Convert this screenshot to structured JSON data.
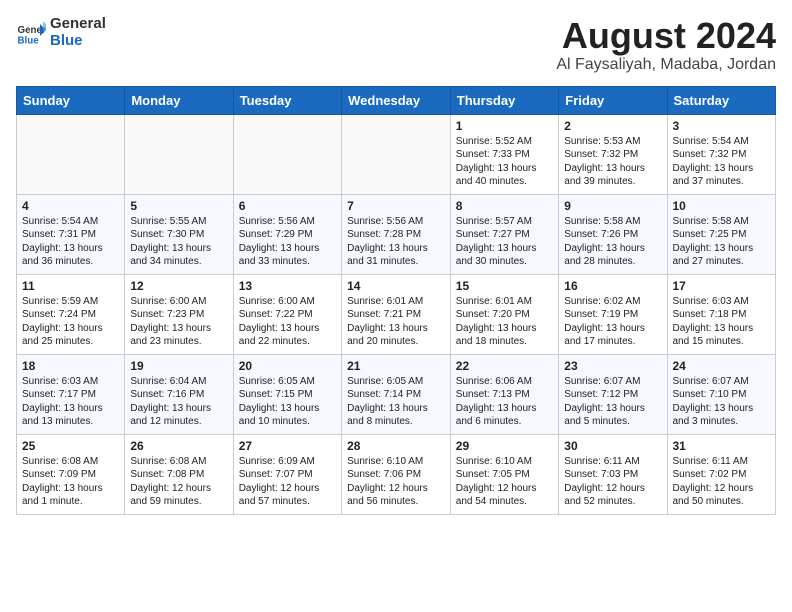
{
  "header": {
    "logo_line1": "General",
    "logo_line2": "Blue",
    "main_title": "August 2024",
    "subtitle": "Al Faysaliyah, Madaba, Jordan"
  },
  "weekdays": [
    "Sunday",
    "Monday",
    "Tuesday",
    "Wednesday",
    "Thursday",
    "Friday",
    "Saturday"
  ],
  "weeks": [
    [
      {
        "day": "",
        "info": ""
      },
      {
        "day": "",
        "info": ""
      },
      {
        "day": "",
        "info": ""
      },
      {
        "day": "",
        "info": ""
      },
      {
        "day": "1",
        "info": "Sunrise: 5:52 AM\nSunset: 7:33 PM\nDaylight: 13 hours\nand 40 minutes."
      },
      {
        "day": "2",
        "info": "Sunrise: 5:53 AM\nSunset: 7:32 PM\nDaylight: 13 hours\nand 39 minutes."
      },
      {
        "day": "3",
        "info": "Sunrise: 5:54 AM\nSunset: 7:32 PM\nDaylight: 13 hours\nand 37 minutes."
      }
    ],
    [
      {
        "day": "4",
        "info": "Sunrise: 5:54 AM\nSunset: 7:31 PM\nDaylight: 13 hours\nand 36 minutes."
      },
      {
        "day": "5",
        "info": "Sunrise: 5:55 AM\nSunset: 7:30 PM\nDaylight: 13 hours\nand 34 minutes."
      },
      {
        "day": "6",
        "info": "Sunrise: 5:56 AM\nSunset: 7:29 PM\nDaylight: 13 hours\nand 33 minutes."
      },
      {
        "day": "7",
        "info": "Sunrise: 5:56 AM\nSunset: 7:28 PM\nDaylight: 13 hours\nand 31 minutes."
      },
      {
        "day": "8",
        "info": "Sunrise: 5:57 AM\nSunset: 7:27 PM\nDaylight: 13 hours\nand 30 minutes."
      },
      {
        "day": "9",
        "info": "Sunrise: 5:58 AM\nSunset: 7:26 PM\nDaylight: 13 hours\nand 28 minutes."
      },
      {
        "day": "10",
        "info": "Sunrise: 5:58 AM\nSunset: 7:25 PM\nDaylight: 13 hours\nand 27 minutes."
      }
    ],
    [
      {
        "day": "11",
        "info": "Sunrise: 5:59 AM\nSunset: 7:24 PM\nDaylight: 13 hours\nand 25 minutes."
      },
      {
        "day": "12",
        "info": "Sunrise: 6:00 AM\nSunset: 7:23 PM\nDaylight: 13 hours\nand 23 minutes."
      },
      {
        "day": "13",
        "info": "Sunrise: 6:00 AM\nSunset: 7:22 PM\nDaylight: 13 hours\nand 22 minutes."
      },
      {
        "day": "14",
        "info": "Sunrise: 6:01 AM\nSunset: 7:21 PM\nDaylight: 13 hours\nand 20 minutes."
      },
      {
        "day": "15",
        "info": "Sunrise: 6:01 AM\nSunset: 7:20 PM\nDaylight: 13 hours\nand 18 minutes."
      },
      {
        "day": "16",
        "info": "Sunrise: 6:02 AM\nSunset: 7:19 PM\nDaylight: 13 hours\nand 17 minutes."
      },
      {
        "day": "17",
        "info": "Sunrise: 6:03 AM\nSunset: 7:18 PM\nDaylight: 13 hours\nand 15 minutes."
      }
    ],
    [
      {
        "day": "18",
        "info": "Sunrise: 6:03 AM\nSunset: 7:17 PM\nDaylight: 13 hours\nand 13 minutes."
      },
      {
        "day": "19",
        "info": "Sunrise: 6:04 AM\nSunset: 7:16 PM\nDaylight: 13 hours\nand 12 minutes."
      },
      {
        "day": "20",
        "info": "Sunrise: 6:05 AM\nSunset: 7:15 PM\nDaylight: 13 hours\nand 10 minutes."
      },
      {
        "day": "21",
        "info": "Sunrise: 6:05 AM\nSunset: 7:14 PM\nDaylight: 13 hours\nand 8 minutes."
      },
      {
        "day": "22",
        "info": "Sunrise: 6:06 AM\nSunset: 7:13 PM\nDaylight: 13 hours\nand 6 minutes."
      },
      {
        "day": "23",
        "info": "Sunrise: 6:07 AM\nSunset: 7:12 PM\nDaylight: 13 hours\nand 5 minutes."
      },
      {
        "day": "24",
        "info": "Sunrise: 6:07 AM\nSunset: 7:10 PM\nDaylight: 13 hours\nand 3 minutes."
      }
    ],
    [
      {
        "day": "25",
        "info": "Sunrise: 6:08 AM\nSunset: 7:09 PM\nDaylight: 13 hours\nand 1 minute."
      },
      {
        "day": "26",
        "info": "Sunrise: 6:08 AM\nSunset: 7:08 PM\nDaylight: 12 hours\nand 59 minutes."
      },
      {
        "day": "27",
        "info": "Sunrise: 6:09 AM\nSunset: 7:07 PM\nDaylight: 12 hours\nand 57 minutes."
      },
      {
        "day": "28",
        "info": "Sunrise: 6:10 AM\nSunset: 7:06 PM\nDaylight: 12 hours\nand 56 minutes."
      },
      {
        "day": "29",
        "info": "Sunrise: 6:10 AM\nSunset: 7:05 PM\nDaylight: 12 hours\nand 54 minutes."
      },
      {
        "day": "30",
        "info": "Sunrise: 6:11 AM\nSunset: 7:03 PM\nDaylight: 12 hours\nand 52 minutes."
      },
      {
        "day": "31",
        "info": "Sunrise: 6:11 AM\nSunset: 7:02 PM\nDaylight: 12 hours\nand 50 minutes."
      }
    ]
  ]
}
